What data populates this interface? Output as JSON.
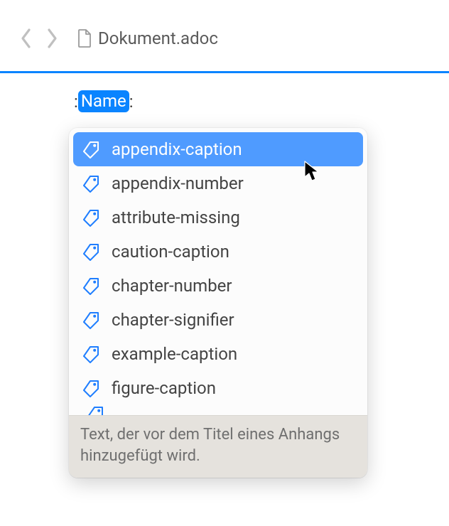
{
  "header": {
    "filename": "Dokument.adoc"
  },
  "editor": {
    "prefix": ":",
    "selected_token": "Name",
    "suffix": ":"
  },
  "suggestions": {
    "items": [
      "appendix-caption",
      "appendix-number",
      "attribute-missing",
      "caution-caption",
      "chapter-number",
      "chapter-signifier",
      "example-caption",
      "figure-caption"
    ],
    "selected_index": 0,
    "description": "Text, der vor dem Titel eines Anhangs hinzugefügt wird."
  },
  "colors": {
    "accent": "#0a84ff",
    "highlight": "#4f9bff",
    "desc_bg": "#e5e2dd"
  }
}
